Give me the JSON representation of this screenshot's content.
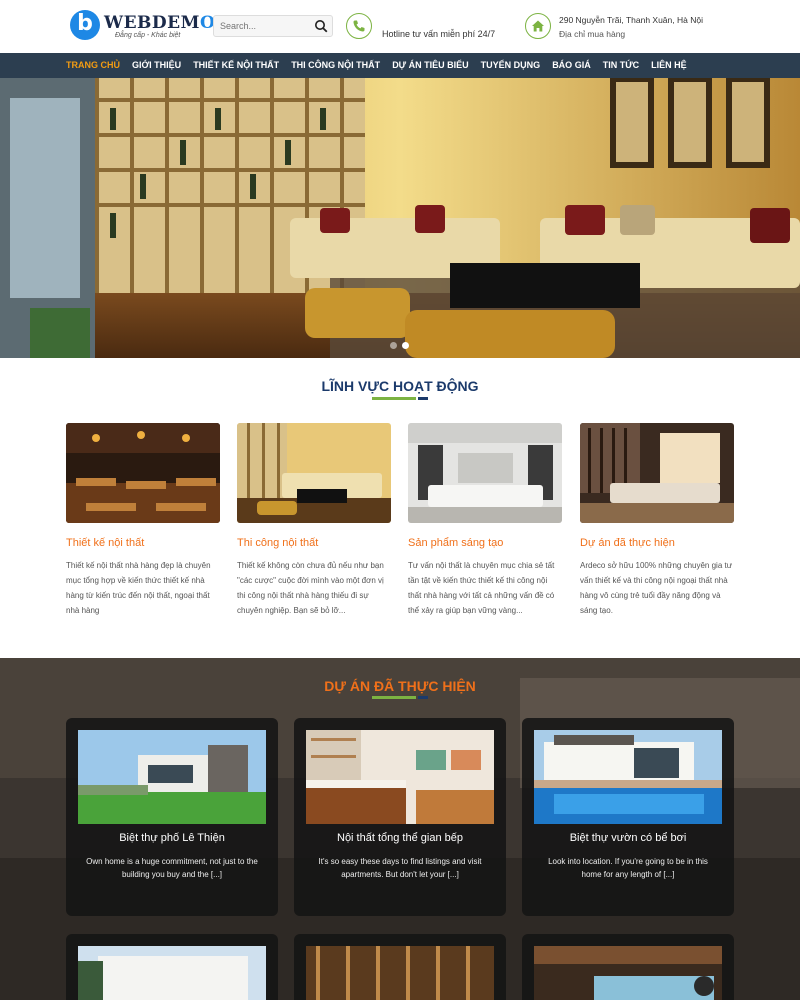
{
  "header": {
    "logo_name": "WEBDEM",
    "logo_name_end": "O",
    "logo_mark": "b",
    "logo_slogan": "Đẳng cấp - Khác biệt",
    "search_placeholder": "Search...",
    "search_icon": "search-icon",
    "hotline": "Hotline tư vấn miễn phí 24/7",
    "address_line1": "290 Nguyễn Trãi, Thanh Xuân, Hà Nội",
    "address_line2": "Địa chỉ mua hàng"
  },
  "nav": {
    "items": [
      {
        "label": "TRANG CHỦ",
        "active": true
      },
      {
        "label": "GIỚI THIỆU"
      },
      {
        "label": "THIẾT KẾ NỘI THẤT"
      },
      {
        "label": "THI CÔNG NỘI THẤT"
      },
      {
        "label": "DỰ ÁN TIÊU BIỂU"
      },
      {
        "label": "TUYỂN DỤNG"
      },
      {
        "label": "BÁO GIÁ"
      },
      {
        "label": "TIN TỨC"
      },
      {
        "label": "LIÊN HỆ"
      }
    ]
  },
  "slider": {
    "slide_count": 2,
    "active_slide": 2
  },
  "fields": {
    "title": "LĨNH VỰC HOẠT ĐỘNG",
    "items": [
      {
        "title": "Thiết kế nội thất",
        "text": "Thiết kế nội thất nhà hàng đẹp là chuyên mục tổng hợp về kiến thức thiết kế nhà hàng từ kiến trúc đến nội thất, ngoại thất nhà hàng"
      },
      {
        "title": "Thi công nội thất",
        "text": "Thiết kế không còn chưa đủ nếu như bạn \"các cược\" cuộc đời mình vào một đơn vị thi công nội thất nhà hàng thiếu đi sự chuyên nghiệp. Bạn sẽ bỏ lỡ..."
      },
      {
        "title": "Sản phẩm sáng tạo",
        "text": "Tư vấn nội thất là chuyên mục chia sẻ tất tần tật về kiến thức thiết kế thi công nội thất nhà hàng với tất cả những vấn đề có thể xảy ra giúp bạn vững vàng..."
      },
      {
        "title": "Dự án đã thực hiện",
        "text": "Ardeco sở hữu 100% những chuyên gia tư vấn thiết kế và thi công nội ngoại thất nhà hàng vô cùng trẻ tuổi đầy năng động và sáng tạo."
      }
    ]
  },
  "projects": {
    "title": "DỰ ÁN ĐÃ THỰC HIỆN",
    "items": [
      {
        "title": "Biệt thự phố Lê Thiện",
        "text": "Own home is a huge commitment, not just to the building you buy and the [...]"
      },
      {
        "title": "Nội thất tổng thể gian bếp",
        "text": "It's so easy these days to find listings and visit apartments. But don't let your [...]"
      },
      {
        "title": "Biệt thự vườn có bể bơi",
        "text": "Look into location. If you're going to be in this home for any length of [...]"
      }
    ]
  },
  "colors": {
    "accent": "#f0701a",
    "nav_bg": "#2c3e50",
    "title_blue": "#1b3a6b",
    "green": "#7cb342",
    "logo_blue": "#1e88e5"
  }
}
